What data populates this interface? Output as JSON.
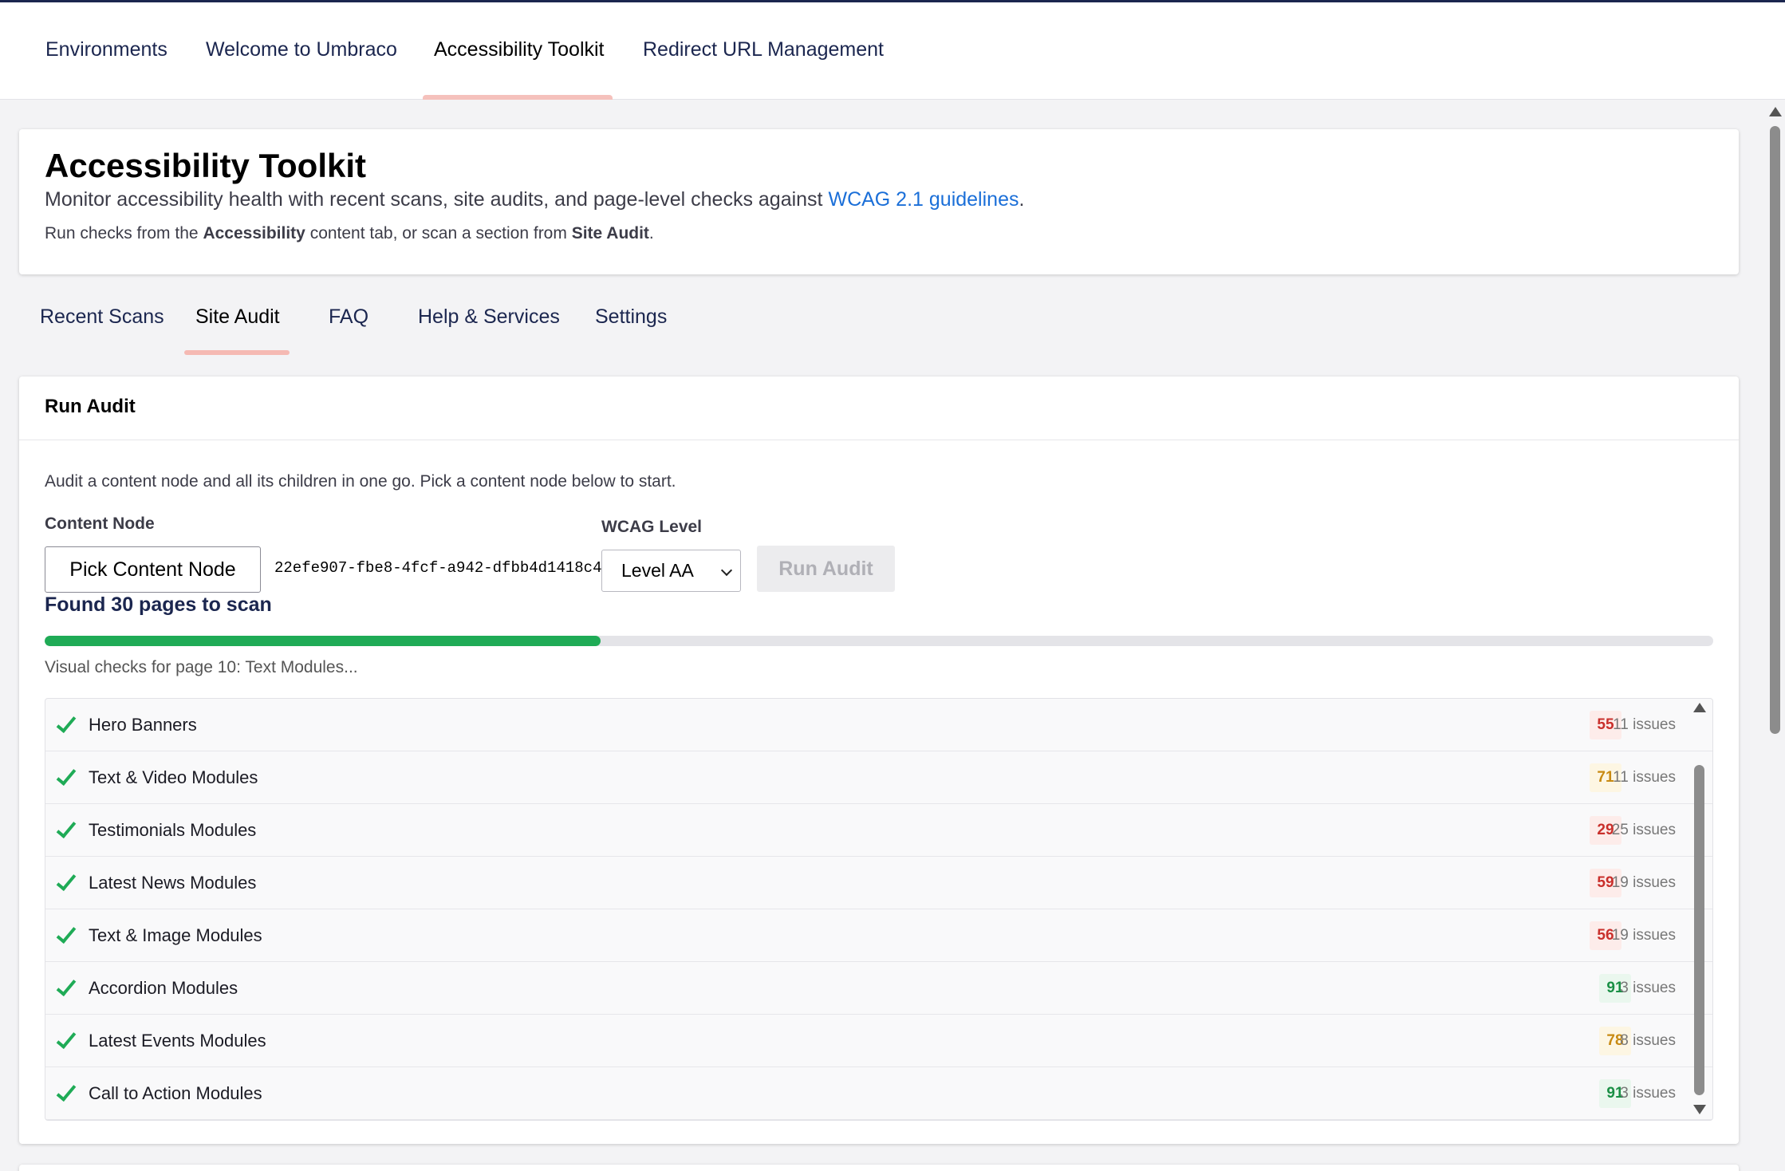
{
  "top_tabs": [
    {
      "label": "Environments",
      "active": false
    },
    {
      "label": "Welcome to Umbraco",
      "active": false
    },
    {
      "label": "Accessibility Toolkit",
      "active": true
    },
    {
      "label": "Redirect URL Management",
      "active": false
    }
  ],
  "header": {
    "title": "Accessibility Toolkit",
    "description_prefix": "Monitor accessibility health with recent scans, site audits, and page-level checks against",
    "description_link": "WCAG 2.1 guidelines",
    "description_suffix": ".",
    "hint_1": "Run checks from the",
    "hint_bold_1": "Accessibility",
    "hint_2": "content tab, or scan a section from",
    "hint_bold_2": "Site Audit",
    "hint_3": "."
  },
  "sub_tabs": [
    {
      "label": "Recent Scans",
      "active": false
    },
    {
      "label": "Site Audit",
      "active": true
    },
    {
      "label": "FAQ",
      "active": false
    },
    {
      "label": "Help & Services",
      "active": false
    },
    {
      "label": "Settings",
      "active": false
    }
  ],
  "audit": {
    "card_title": "Run Audit",
    "description": "Audit a content node and all its children in one go. Pick a content node below to start.",
    "content_node_label": "Content Node",
    "pick_button": "Pick Content Node",
    "node_id": "22efe907-fbe8-4fcf-a942-dfbb4d1418c4",
    "wcag_label": "WCAG Level",
    "wcag_value": "Level AA",
    "run_button": "Run Audit",
    "found_text": "Found 30 pages to scan",
    "progress_fraction": 0.333,
    "status": "Visual checks for page 10: Text Modules..."
  },
  "results": [
    {
      "name": "Hero Banners",
      "score": "55",
      "level": "red",
      "issues": "11 issues"
    },
    {
      "name": "Text & Video Modules",
      "score": "71",
      "level": "amber",
      "issues": "11 issues"
    },
    {
      "name": "Testimonials Modules",
      "score": "29",
      "level": "red",
      "issues": "25 issues"
    },
    {
      "name": "Latest News Modules",
      "score": "59",
      "level": "red",
      "issues": "19 issues"
    },
    {
      "name": "Text & Image Modules",
      "score": "56",
      "level": "red",
      "issues": "19 issues"
    },
    {
      "name": "Accordion Modules",
      "score": "91",
      "level": "green",
      "issues": "3 issues"
    },
    {
      "name": "Latest Events Modules",
      "score": "78",
      "level": "amber",
      "issues": "8 issues"
    },
    {
      "name": "Call to Action Modules",
      "score": "91",
      "level": "green",
      "issues": "3 issues"
    }
  ],
  "icons": {
    "check": "check-icon",
    "select_chevron": "chevron-down-icon"
  },
  "colors": {
    "brand_navy": "#1b264f",
    "accent_tab": "#f5c1bc",
    "progress": "#1fab56",
    "link": "#1b6fd8"
  }
}
